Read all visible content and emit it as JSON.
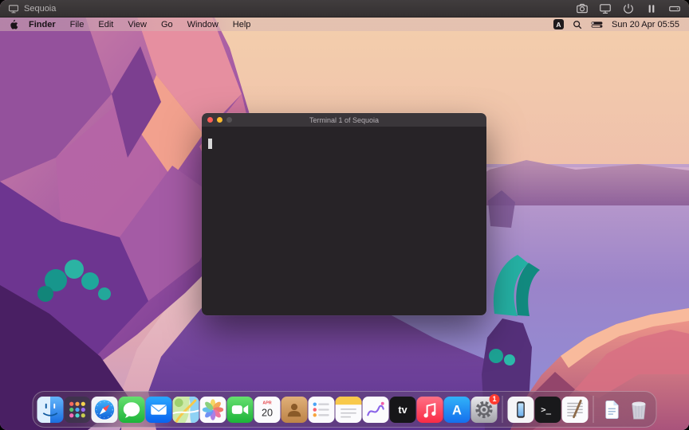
{
  "vm_toolbar": {
    "title": "Sequoia",
    "buttons": [
      "screenshot",
      "display",
      "power",
      "pause",
      "drive"
    ]
  },
  "menu_bar": {
    "items": [
      "Finder",
      "File",
      "Edit",
      "View",
      "Go",
      "Window",
      "Help"
    ],
    "input_source": "A",
    "icons": [
      "search-icon",
      "control-center-icon"
    ],
    "clock": "Sun 20 Apr 05:55"
  },
  "terminal_window": {
    "title": "Terminal 1 of Sequoia",
    "traffic_lights": [
      "close",
      "minimize",
      "zoom"
    ],
    "cursor": "block"
  },
  "dock": {
    "apps": [
      "Finder",
      "Launchpad",
      "Safari",
      "Messages",
      "Mail",
      "Maps",
      "Photos",
      "FaceTime",
      "Calendar",
      "Contacts",
      "Reminders",
      "Notes",
      "Freeform",
      "TV",
      "Music",
      "App Store",
      "System Settings",
      "iPhone Mirroring",
      "Terminal",
      "TextEdit",
      "Downloads",
      "Trash"
    ],
    "calendar": {
      "month": "APR",
      "day": "20"
    },
    "tv_label": "tv",
    "appstore_glyph": "A",
    "terminal_glyph": ">_",
    "settings_badge": "1"
  },
  "colors": {
    "menubar_tint": "#cfb2ae",
    "terminal_bg": "#272327",
    "titlebar_bg": "#3a363a",
    "dock_tint": "rgba(95,75,95,0.32)",
    "badge_red": "#ff3b30",
    "traffic_red": "#ff5f57",
    "traffic_yellow": "#febc2e",
    "teal_accent": "#25b1a4"
  }
}
